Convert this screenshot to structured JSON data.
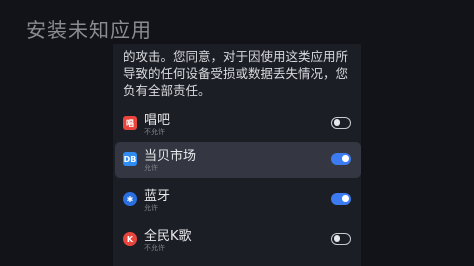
{
  "header": {
    "title": "安装未知应用"
  },
  "warning": {
    "text": "的攻击。您同意，对于因使用这类应用所导致的任何设备受损或数据丢失情况，您负有全部责任。"
  },
  "apps": [
    {
      "name": "唱吧",
      "permission": "不允许",
      "enabled": false,
      "icon": "changba-icon",
      "icon_glyph": "唱",
      "icon_color": "#e8453c",
      "focused": false
    },
    {
      "name": "当贝市场",
      "permission": "允许",
      "enabled": true,
      "icon": "dangbei-market-icon",
      "icon_glyph": "DB",
      "icon_color": "#2f8cf2",
      "focused": true
    },
    {
      "name": "蓝牙",
      "permission": "允许",
      "enabled": true,
      "icon": "bluetooth-icon",
      "icon_glyph": "✱",
      "icon_color": "#2a6fe0",
      "focused": false
    },
    {
      "name": "全民K歌",
      "permission": "不允许",
      "enabled": false,
      "icon": "quanmin-kge-icon",
      "icon_glyph": "K",
      "icon_color": "#e8453c",
      "focused": false
    }
  ],
  "colors": {
    "accent": "#3c7cf0",
    "background": "#121319",
    "panel": "#1c1e25",
    "focus": "#343741"
  }
}
